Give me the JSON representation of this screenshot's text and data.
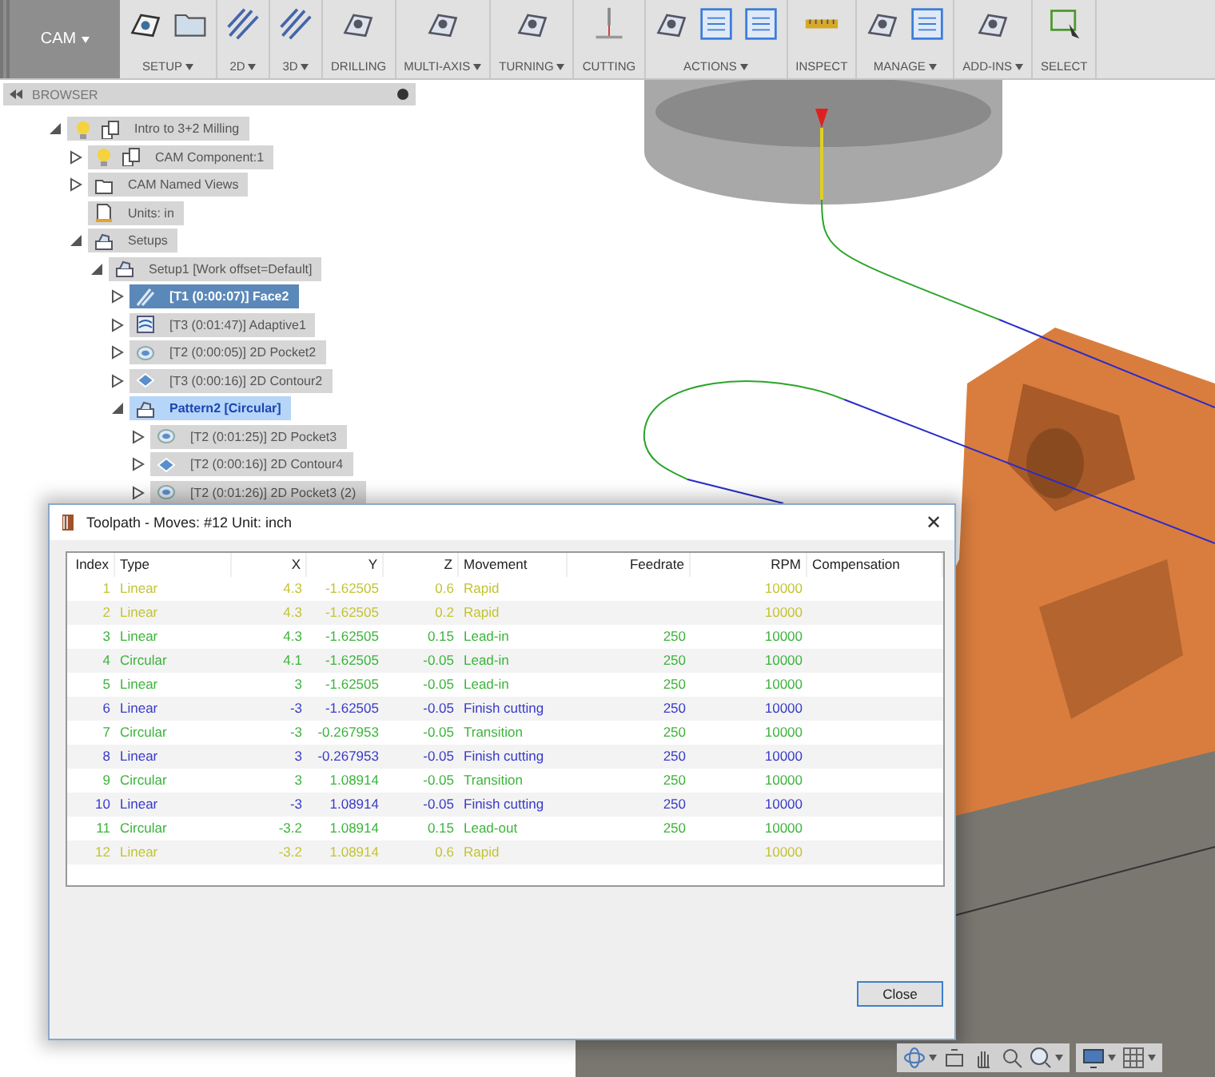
{
  "workspace": {
    "label": "CAM",
    "dropdown": true
  },
  "toolbar": [
    {
      "label": "SETUP",
      "dropdown": true,
      "icons": [
        {
          "kind": "setup"
        },
        {
          "kind": "folder"
        }
      ]
    },
    {
      "label": "2D",
      "dropdown": true,
      "icons": [
        {
          "kind": "hatch"
        }
      ]
    },
    {
      "label": "3D",
      "dropdown": true,
      "icons": [
        {
          "kind": "hatch"
        }
      ]
    },
    {
      "label": "DRILLING",
      "dropdown": false,
      "icons": [
        {
          "kind": "part"
        }
      ]
    },
    {
      "label": "MULTI-AXIS",
      "dropdown": true,
      "icons": [
        {
          "kind": "part"
        }
      ]
    },
    {
      "label": "TURNING",
      "dropdown": true,
      "icons": [
        {
          "kind": "part"
        }
      ]
    },
    {
      "label": "CUTTING",
      "dropdown": false,
      "icons": [
        {
          "kind": "cutting"
        }
      ]
    },
    {
      "label": "ACTIONS",
      "dropdown": true,
      "icons": [
        {
          "kind": "part"
        },
        {
          "kind": "sheet"
        },
        {
          "kind": "sheet"
        }
      ]
    },
    {
      "label": "INSPECT",
      "dropdown": false,
      "icons": [
        {
          "kind": "ruler"
        }
      ]
    },
    {
      "label": "MANAGE",
      "dropdown": true,
      "icons": [
        {
          "kind": "part"
        },
        {
          "kind": "sheet"
        }
      ]
    },
    {
      "label": "ADD-INS",
      "dropdown": true,
      "icons": [
        {
          "kind": "part"
        }
      ]
    },
    {
      "label": "SELECT",
      "dropdown": false,
      "icons": [
        {
          "kind": "select"
        }
      ]
    }
  ],
  "browser": {
    "title": "BROWSER",
    "tree": [
      {
        "label": "Intro to 3+2 Milling",
        "icons": [
          {
            "kind": "bulb"
          },
          {
            "kind": "component"
          }
        ],
        "expanded": true,
        "selected": false,
        "highlighted": false,
        "children": [
          {
            "label": "CAM Component:1",
            "icons": [
              {
                "kind": "bulb"
              },
              {
                "kind": "component"
              }
            ],
            "expanded": false,
            "selected": false,
            "highlighted": false
          },
          {
            "label": "CAM Named Views",
            "icons": [
              {
                "kind": "folder"
              }
            ],
            "expanded": false,
            "selected": false,
            "highlighted": false
          },
          {
            "label": "Units: in",
            "icons": [
              {
                "kind": "document"
              }
            ],
            "selected": false,
            "highlighted": false
          },
          {
            "label": "Setups",
            "icons": [
              {
                "kind": "setup"
              }
            ],
            "expanded": true,
            "selected": false,
            "highlighted": false,
            "children": [
              {
                "label": "Setup1 [Work offset=Default]",
                "icons": [
                  {
                    "kind": "setup"
                  }
                ],
                "expanded": true,
                "selected": false,
                "highlighted": false,
                "children": [
                  {
                    "label": "[T1 (0:00:07)] Face2",
                    "icons": [
                      {
                        "kind": "face"
                      }
                    ],
                    "expanded": false,
                    "selected": true,
                    "highlighted": false
                  },
                  {
                    "label": "[T3 (0:01:47)] Adaptive1",
                    "icons": [
                      {
                        "kind": "adaptive"
                      }
                    ],
                    "expanded": false,
                    "selected": false,
                    "highlighted": false
                  },
                  {
                    "label": "[T2 (0:00:05)] 2D Pocket2",
                    "icons": [
                      {
                        "kind": "pocket"
                      }
                    ],
                    "expanded": false,
                    "selected": false,
                    "highlighted": false
                  },
                  {
                    "label": "[T3 (0:00:16)] 2D Contour2",
                    "icons": [
                      {
                        "kind": "contour"
                      }
                    ],
                    "expanded": false,
                    "selected": false,
                    "highlighted": false
                  },
                  {
                    "label": "Pattern2 [Circular]",
                    "icons": [
                      {
                        "kind": "setup"
                      }
                    ],
                    "expanded": true,
                    "selected": false,
                    "highlighted": true,
                    "children": [
                      {
                        "label": "[T2 (0:01:25)] 2D Pocket3",
                        "icons": [
                          {
                            "kind": "pocket"
                          }
                        ],
                        "expanded": false,
                        "selected": false,
                        "highlighted": false
                      },
                      {
                        "label": "[T2 (0:00:16)] 2D Contour4",
                        "icons": [
                          {
                            "kind": "contour"
                          }
                        ],
                        "expanded": false,
                        "selected": false,
                        "highlighted": false
                      },
                      {
                        "label": "[T2 (0:01:26)] 2D Pocket3 (2)",
                        "icons": [
                          {
                            "kind": "pocket"
                          }
                        ],
                        "expanded": false,
                        "selected": false,
                        "highlighted": false
                      }
                    ]
                  }
                ]
              }
            ]
          }
        ]
      }
    ]
  },
  "dialog": {
    "title": "Toolpath - Moves: #12 Unit: inch",
    "close_symbol": "✕",
    "columns": [
      "Index",
      "Type",
      "X",
      "Y",
      "Z",
      "Movement",
      "Feedrate",
      "RPM",
      "Compensation"
    ],
    "rows": [
      {
        "color": "#c3c336",
        "cells": [
          "1",
          "Linear",
          "4.3",
          "-1.62505",
          "0.6",
          "Rapid",
          "",
          "10000",
          ""
        ]
      },
      {
        "color": "#c3c336",
        "cells": [
          "2",
          "Linear",
          "4.3",
          "-1.62505",
          "0.2",
          "Rapid",
          "",
          "10000",
          ""
        ]
      },
      {
        "color": "#3cb43c",
        "cells": [
          "3",
          "Linear",
          "4.3",
          "-1.62505",
          "0.15",
          "Lead-in",
          "250",
          "10000",
          ""
        ]
      },
      {
        "color": "#3cb43c",
        "cells": [
          "4",
          "Circular",
          "4.1",
          "-1.62505",
          "-0.05",
          "Lead-in",
          "250",
          "10000",
          ""
        ]
      },
      {
        "color": "#3cb43c",
        "cells": [
          "5",
          "Linear",
          "3",
          "-1.62505",
          "-0.05",
          "Lead-in",
          "250",
          "10000",
          ""
        ]
      },
      {
        "color": "#3a3ac8",
        "cells": [
          "6",
          "Linear",
          "-3",
          "-1.62505",
          "-0.05",
          "Finish cutting",
          "250",
          "10000",
          ""
        ]
      },
      {
        "color": "#3cb43c",
        "cells": [
          "7",
          "Circular",
          "-3",
          "-0.267953",
          "-0.05",
          "Transition",
          "250",
          "10000",
          ""
        ]
      },
      {
        "color": "#3a3ac8",
        "cells": [
          "8",
          "Linear",
          "3",
          "-0.267953",
          "-0.05",
          "Finish cutting",
          "250",
          "10000",
          ""
        ]
      },
      {
        "color": "#3cb43c",
        "cells": [
          "9",
          "Circular",
          "3",
          "1.08914",
          "-0.05",
          "Transition",
          "250",
          "10000",
          ""
        ]
      },
      {
        "color": "#3a3ac8",
        "cells": [
          "10",
          "Linear",
          "-3",
          "1.08914",
          "-0.05",
          "Finish cutting",
          "250",
          "10000",
          ""
        ]
      },
      {
        "color": "#3cb43c",
        "cells": [
          "11",
          "Circular",
          "-3.2",
          "1.08914",
          "0.15",
          "Lead-out",
          "250",
          "10000",
          ""
        ]
      },
      {
        "color": "#c3c336",
        "cells": [
          "12",
          "Linear",
          "-3.2",
          "1.08914",
          "0.6",
          "Rapid",
          "",
          "10000",
          ""
        ]
      }
    ],
    "button": "Close"
  },
  "nav_bar": [
    {
      "kind": "orbit",
      "dropdown": true
    },
    {
      "kind": "look-at",
      "dropdown": false
    },
    {
      "kind": "pan",
      "dropdown": false
    },
    {
      "kind": "zoom",
      "dropdown": false
    },
    {
      "kind": "fit",
      "dropdown": true
    },
    {
      "kind": "display",
      "dropdown": true
    },
    {
      "kind": "grid",
      "dropdown": true
    }
  ]
}
